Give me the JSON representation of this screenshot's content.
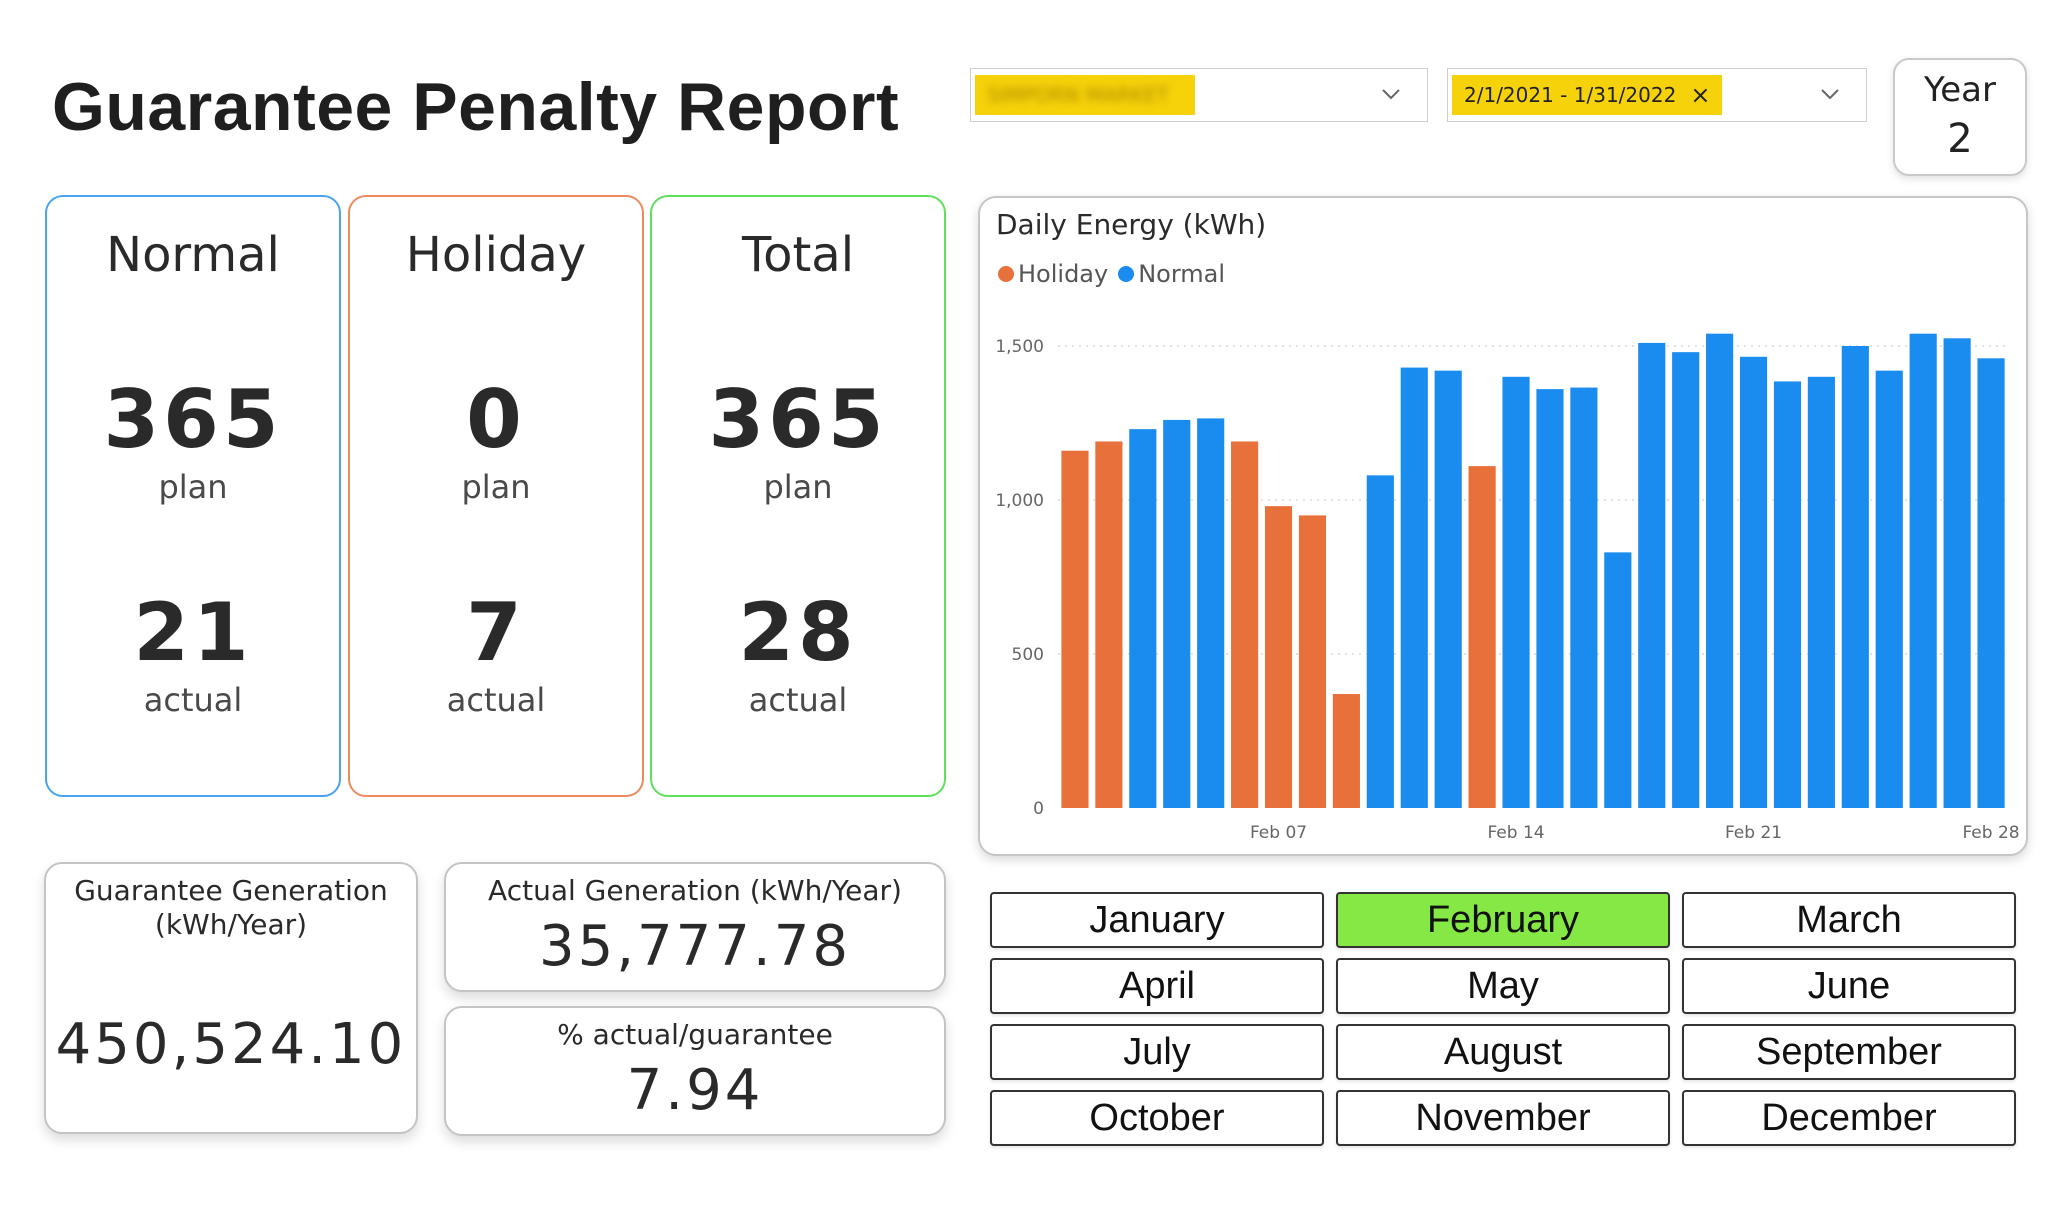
{
  "report": {
    "title": "Guarantee Penalty Report"
  },
  "filters": {
    "site": {
      "value": "SIMPORN MARKET",
      "redacted": true
    },
    "date_range": {
      "value": "2/1/2021 - 1/31/2022",
      "clear": "×"
    }
  },
  "year_card": {
    "label": "Year",
    "value": "2"
  },
  "kpis": {
    "normal": {
      "title": "Normal",
      "plan": "365",
      "plan_label": "plan",
      "actual": "21",
      "actual_label": "actual",
      "color": "#4ba3ef"
    },
    "holiday": {
      "title": "Holiday",
      "plan": "0",
      "plan_label": "plan",
      "actual": "7",
      "actual_label": "actual",
      "color": "#ee8a60"
    },
    "total": {
      "title": "Total",
      "plan": "365",
      "plan_label": "plan",
      "actual": "28",
      "actual_label": "actual",
      "color": "#5de05a"
    }
  },
  "guarantee": {
    "label_line1": "Guarantee Generation",
    "label_line2": "(kWh/Year)",
    "value": "450,524.10"
  },
  "actual_generation": {
    "label": "Actual Generation (kWh/Year)",
    "value": "35,777.78"
  },
  "percent": {
    "label": "% actual/guarantee",
    "value": "7.94"
  },
  "chart_data": {
    "type": "bar",
    "title": "Daily Energy (kWh)",
    "legend": [
      {
        "name": "Holiday",
        "color": "#e8703a"
      },
      {
        "name": "Normal",
        "color": "#1a8cf0"
      }
    ],
    "ylim": [
      0,
      1500
    ],
    "yticks": [
      "0",
      "500",
      "1,000",
      "1,500"
    ],
    "xtick_labels": [
      {
        "day": 7,
        "label": "Feb 07"
      },
      {
        "day": 14,
        "label": "Feb 14"
      },
      {
        "day": 21,
        "label": "Feb 21"
      },
      {
        "day": 28,
        "label": "Feb 28"
      }
    ],
    "grid": "horizontal dotted",
    "categories": [
      "1",
      "2",
      "3",
      "4",
      "5",
      "6",
      "7",
      "8",
      "9",
      "10",
      "11",
      "12",
      "13",
      "14",
      "15",
      "16",
      "17",
      "18",
      "19",
      "20",
      "21",
      "22",
      "23",
      "24",
      "25",
      "26",
      "27",
      "28"
    ],
    "values": [
      1160,
      1190,
      1230,
      1260,
      1265,
      1190,
      980,
      950,
      370,
      1080,
      1430,
      1420,
      1110,
      1400,
      1360,
      1365,
      830,
      1510,
      1480,
      1540,
      1465,
      1385,
      1400,
      1500,
      1420,
      1540,
      1525,
      1460
    ],
    "series_type": [
      "Holiday",
      "Holiday",
      "Normal",
      "Normal",
      "Normal",
      "Holiday",
      "Holiday",
      "Holiday",
      "Holiday",
      "Normal",
      "Normal",
      "Normal",
      "Holiday",
      "Normal",
      "Normal",
      "Normal",
      "Normal",
      "Normal",
      "Normal",
      "Normal",
      "Normal",
      "Normal",
      "Normal",
      "Normal",
      "Normal",
      "Normal",
      "Normal",
      "Normal"
    ]
  },
  "months": {
    "selected": "February",
    "items": [
      "January",
      "February",
      "March",
      "April",
      "May",
      "June",
      "July",
      "August",
      "September",
      "October",
      "November",
      "December"
    ]
  }
}
